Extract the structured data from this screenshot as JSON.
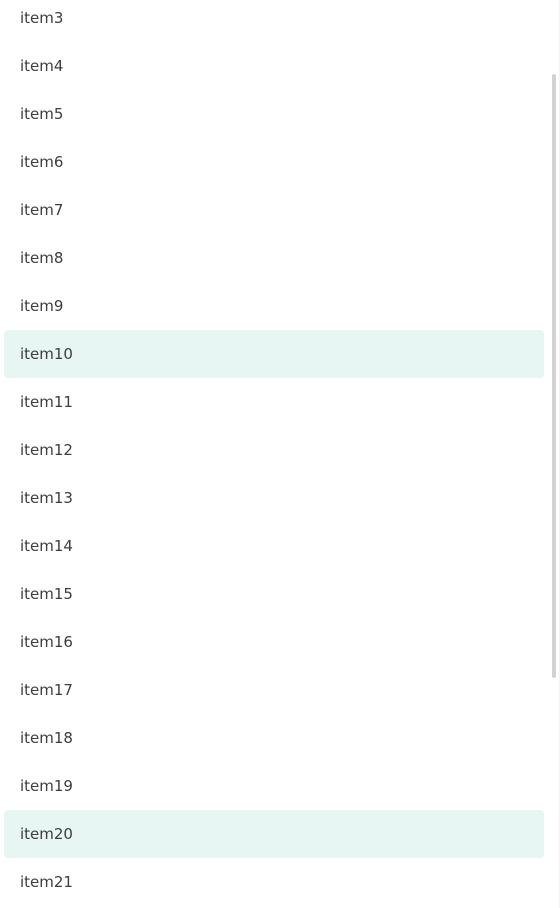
{
  "list": {
    "items": [
      {
        "label": "item3",
        "selected": false
      },
      {
        "label": "item4",
        "selected": false
      },
      {
        "label": "item5",
        "selected": false
      },
      {
        "label": "item6",
        "selected": false
      },
      {
        "label": "item7",
        "selected": false
      },
      {
        "label": "item8",
        "selected": false
      },
      {
        "label": "item9",
        "selected": false
      },
      {
        "label": "item10",
        "selected": true
      },
      {
        "label": "item11",
        "selected": false
      },
      {
        "label": "item12",
        "selected": false
      },
      {
        "label": "item13",
        "selected": false
      },
      {
        "label": "item14",
        "selected": false
      },
      {
        "label": "item15",
        "selected": false
      },
      {
        "label": "item16",
        "selected": false
      },
      {
        "label": "item17",
        "selected": false
      },
      {
        "label": "item18",
        "selected": false
      },
      {
        "label": "item19",
        "selected": false
      },
      {
        "label": "item20",
        "selected": true
      },
      {
        "label": "item21",
        "selected": false
      }
    ]
  },
  "colors": {
    "selected_background": "#e7f6f3",
    "text": "#3d3d3d",
    "scrollbar_thumb": "#d2d2d2"
  }
}
